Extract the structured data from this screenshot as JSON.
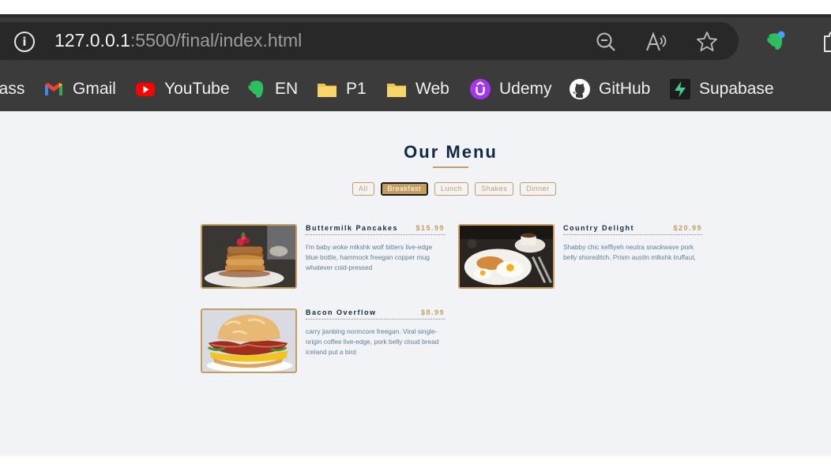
{
  "browser": {
    "url_host": "127.0.0.1",
    "url_path": ":5500/final/index.html",
    "bookmarks": [
      {
        "label": "lass",
        "icon": "folder-icon"
      },
      {
        "label": "Gmail",
        "icon": "gmail-icon"
      },
      {
        "label": "YouTube",
        "icon": "youtube-icon"
      },
      {
        "label": "EN",
        "icon": "evernote-icon"
      },
      {
        "label": "P1",
        "icon": "folder-icon"
      },
      {
        "label": "Web",
        "icon": "folder-icon"
      },
      {
        "label": "Udemy",
        "icon": "udemy-icon"
      },
      {
        "label": "GitHub",
        "icon": "github-icon"
      },
      {
        "label": "Supabase",
        "icon": "supabase-icon"
      }
    ]
  },
  "menu": {
    "title": "Our Menu",
    "accent_color": "#c59d5f",
    "filters": [
      "All",
      "Breakfast",
      "Lunch",
      "Shakes",
      "Dinner"
    ],
    "active_filter": "Breakfast",
    "items": [
      {
        "name": "Buttermilk Pancakes",
        "price": "$15.99",
        "desc": "I'm baby woke mlkshk wolf bitters live-edge blue bottle, hammock freegan copper mug whatever cold-pressed",
        "image": "pancakes-photo"
      },
      {
        "name": "Country Delight",
        "price": "$20.99",
        "desc": "Shabby chic keffiyeh neutra snackwave pork belly shoreditch. Prism austin mlkshk truffaut,",
        "image": "eggs-breakfast-photo"
      },
      {
        "name": "Bacon Overflow",
        "price": "$8.99",
        "desc": "carry jianbing normcore freegan. Viral single-origin coffee live-edge, pork belly cloud bread iceland put a bird",
        "image": "bacon-sandwich-photo"
      }
    ]
  }
}
